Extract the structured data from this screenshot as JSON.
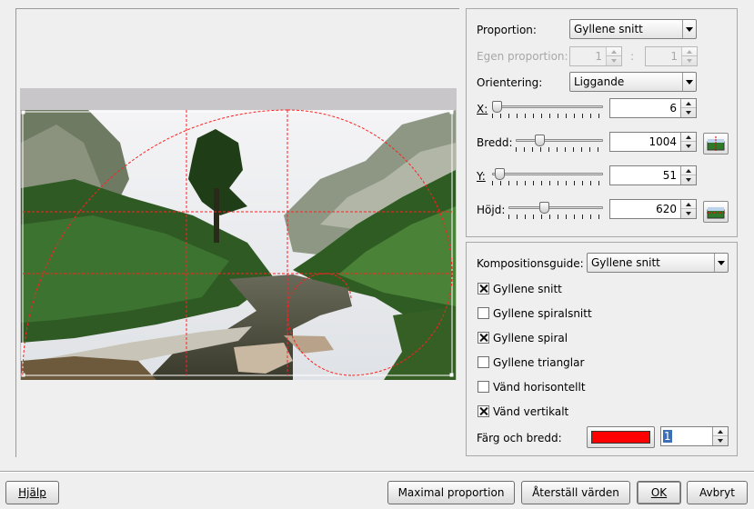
{
  "crop": {
    "proportion_label": "Proportion:",
    "proportion_value": "Gyllene snitt",
    "custom_proportion_label": "Egen proportion:",
    "custom_ratio_num": "1",
    "custom_ratio_sep": ":",
    "custom_ratio_den": "1",
    "orientation_label": "Orientering:",
    "orientation_value": "Liggande",
    "x_label": "X:",
    "x_value": "6",
    "width_label": "Bredd:",
    "width_value": "1004",
    "y_label": "Y:",
    "y_value": "51",
    "height_label": "Höjd:",
    "height_value": "620"
  },
  "guide": {
    "composition_label": "Kompositionsguide:",
    "composition_value": "Gyllene snitt",
    "options": [
      {
        "label": "Gyllene snitt",
        "checked": true
      },
      {
        "label": "Gyllene spiralsnitt",
        "checked": false
      },
      {
        "label": "Gyllene spiral",
        "checked": true
      },
      {
        "label": "Gyllene trianglar",
        "checked": false
      },
      {
        "label": "Vänd horisontellt",
        "checked": false
      },
      {
        "label": "Vänd vertikalt",
        "checked": true
      }
    ],
    "color_width_label": "Färg och bredd:",
    "guide_color": "#ff0000",
    "guide_width": "1"
  },
  "buttons": {
    "help": "Hjälp",
    "max_aspect": "Maximal proportion",
    "reset": "Återställ värden",
    "ok": "OK",
    "cancel": "Avbryt"
  },
  "colors": {
    "guide_line": "#ff2020",
    "dialog_bg": "#efefef"
  }
}
